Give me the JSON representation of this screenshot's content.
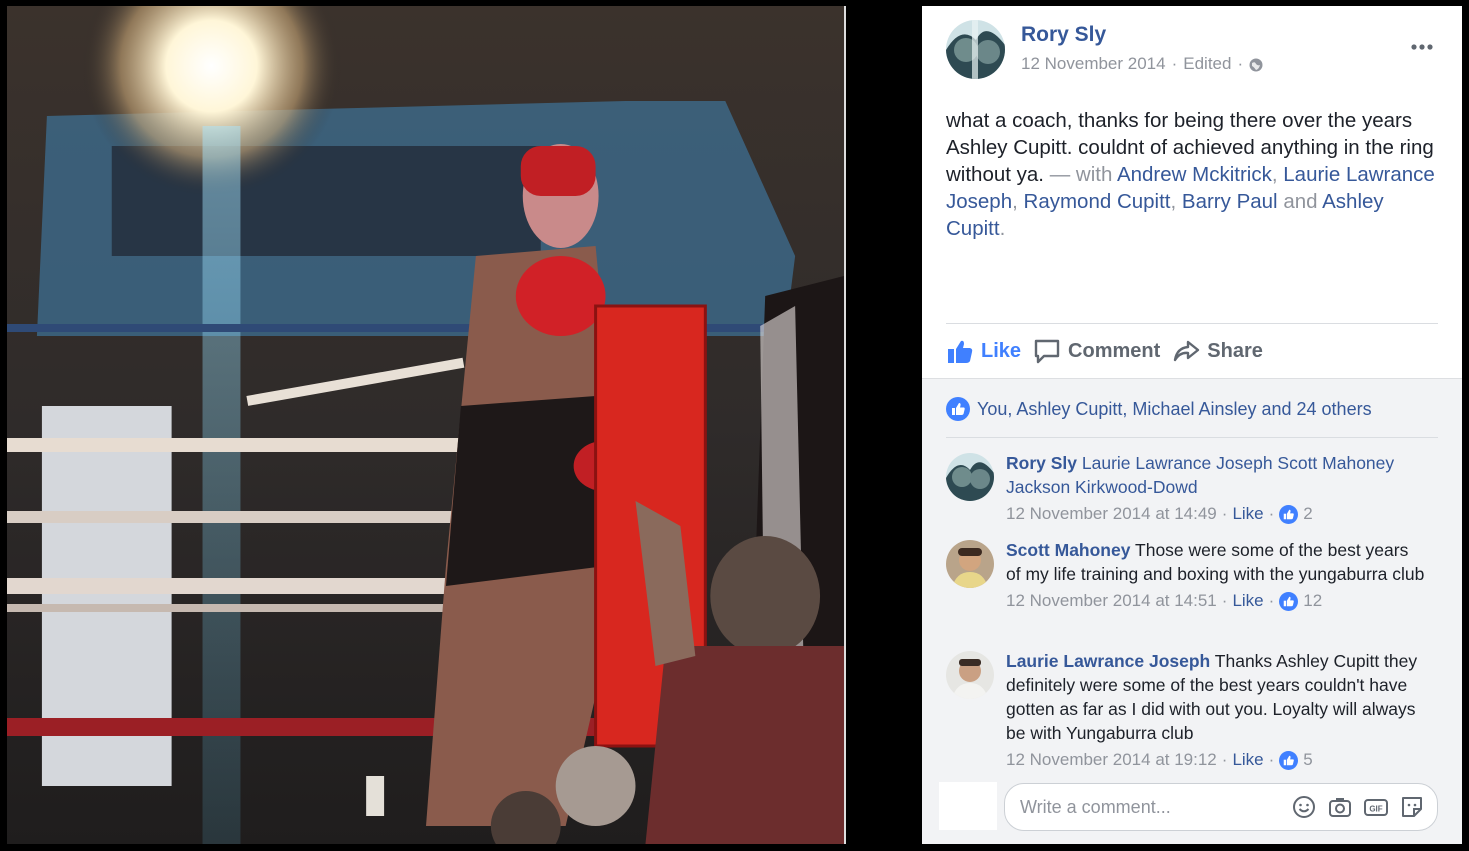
{
  "post": {
    "author": "Rory Sly",
    "date": "12 November 2014",
    "edited": "Edited",
    "separator": "·",
    "text_intro": "what a coach, thanks for being there over the years Ashley Cupitt. couldnt of achieved anything in the ring without ya.",
    "with_prefix": "— with",
    "tagged": [
      "Andrew Mckitrick",
      "Laurie Lawrance Joseph",
      "Raymond Cupitt",
      "Barry Paul",
      "Ashley Cupitt"
    ],
    "comma": ",",
    "and_word": "and",
    "period": "."
  },
  "actions": {
    "like": "Like",
    "comment": "Comment",
    "share": "Share"
  },
  "reactions": {
    "summary": "You, Ashley Cupitt, Michael Ainsley and 24 others"
  },
  "comments": [
    {
      "author": "Rory Sly",
      "text": "",
      "tags": "Laurie Lawrance Joseph Scott Mahoney Jackson Kirkwood-Dowd",
      "time": "12 November 2014 at 14:49",
      "like_label": "Like",
      "likes": "2"
    },
    {
      "author": "Scott Mahoney",
      "text": "Those were some of the best years of my life training and boxing with the yungaburra club",
      "tags": "",
      "time": "12 November 2014 at 14:51",
      "like_label": "Like",
      "likes": "12"
    },
    {
      "author": "Laurie Lawrance Joseph",
      "text": "Thanks Ashley Cupitt they definitely were some of the best years couldn't have gotten as far as I did with out you. Loyalty will always be with Yungaburra club",
      "tags": "",
      "time": "12 November 2014 at 19:12",
      "like_label": "Like",
      "likes": "5"
    }
  ],
  "composer": {
    "placeholder": "Write a comment..."
  },
  "colors": {
    "link": "#365899",
    "meta": "#90949c",
    "like_blue": "#4080ff"
  },
  "icons": [
    "globe-icon",
    "more-icon",
    "like-icon",
    "comment-icon",
    "share-icon",
    "like-reaction-icon",
    "emoji-icon",
    "camera-icon",
    "gif-icon",
    "sticker-icon"
  ]
}
